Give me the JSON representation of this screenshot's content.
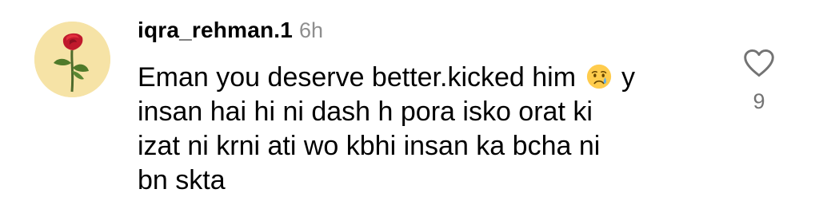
{
  "comment": {
    "avatar_icon": "rose-avatar-icon",
    "username": "iqra_rehman.1",
    "timestamp": "6h",
    "text_lines": [
      "Eman you deserve better.kicked him",
      "y",
      "insan hai hi ni dash h pora isko orat ki",
      "izat ni krni ati wo kbhi insan ka bcha ni",
      "bn skta"
    ],
    "emoji_icon": "crying-face-emoji-icon",
    "like_icon": "heart-outline-icon",
    "like_count": "9"
  },
  "colors": {
    "text": "#000000",
    "timestamp": "#8e8e8e",
    "like_count": "#737373",
    "avatar_bg": "#f6e3a6"
  }
}
